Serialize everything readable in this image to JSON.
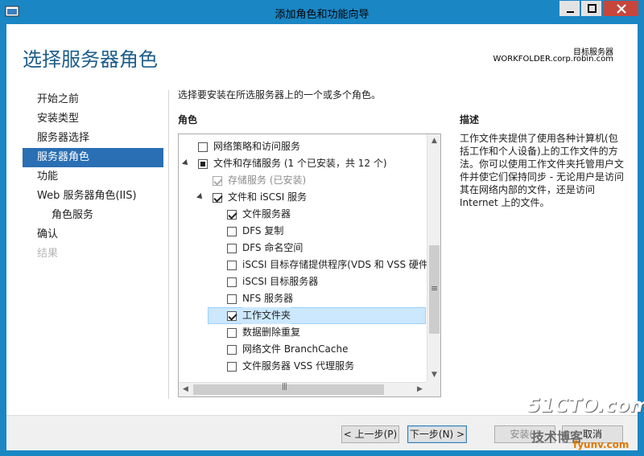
{
  "window": {
    "title": "添加角色和功能向导",
    "accent": "#1a86c4"
  },
  "header": {
    "page_title": "选择服务器角色",
    "dest_label": "目标服务器",
    "dest_server": "WORKFOLDER.corp.robin.com"
  },
  "nav": {
    "items": [
      {
        "label": "开始之前"
      },
      {
        "label": "安装类型"
      },
      {
        "label": "服务器选择"
      },
      {
        "label": "服务器角色"
      },
      {
        "label": "功能"
      },
      {
        "label": "Web 服务器角色(IIS)"
      },
      {
        "label": "角色服务"
      },
      {
        "label": "确认"
      },
      {
        "label": "结果"
      }
    ]
  },
  "main": {
    "instruction": "选择要安装在所选服务器上的一个或多个角色。",
    "roles_header": "角色",
    "roles": [
      {
        "label": "网络策略和访问服务",
        "state": "unchecked"
      },
      {
        "label": "文件和存储服务 (1 个已安装，共 12 个)",
        "state": "partial"
      },
      {
        "label": "存储服务 (已安装)",
        "state": "checked-disabled"
      },
      {
        "label": "文件和 iSCSI 服务",
        "state": "checked"
      },
      {
        "label": "文件服务器",
        "state": "checked"
      },
      {
        "label": "DFS 复制",
        "state": "unchecked"
      },
      {
        "label": "DFS 命名空间",
        "state": "unchecked"
      },
      {
        "label": "iSCSI 目标存储提供程序(VDS 和 VSS 硬件提",
        "state": "unchecked"
      },
      {
        "label": "iSCSI 目标服务器",
        "state": "unchecked"
      },
      {
        "label": "NFS 服务器",
        "state": "unchecked"
      },
      {
        "label": "工作文件夹",
        "state": "checked"
      },
      {
        "label": "数据删除重复",
        "state": "unchecked"
      },
      {
        "label": "网络文件 BranchCache",
        "state": "unchecked"
      },
      {
        "label": "文件服务器 VSS 代理服务",
        "state": "unchecked"
      }
    ],
    "description_header": "描述",
    "description": "工作文件夹提供了使用各种计算机(包括工作和个人设备)上的工作文件的方法。你可以使用工作文件夹托管用户文件并使它们保持同步 - 无论用户是访问其在网络内部的文件，还是访问 Internet 上的文件。"
  },
  "buttons": {
    "prev": "< 上一步(P)",
    "next": "下一步(N) >",
    "install": "安装(I)",
    "cancel": "取消"
  },
  "watermark": {
    "big": "51CTO.com",
    "small": "技术博客",
    "site": "fyunv.com"
  }
}
